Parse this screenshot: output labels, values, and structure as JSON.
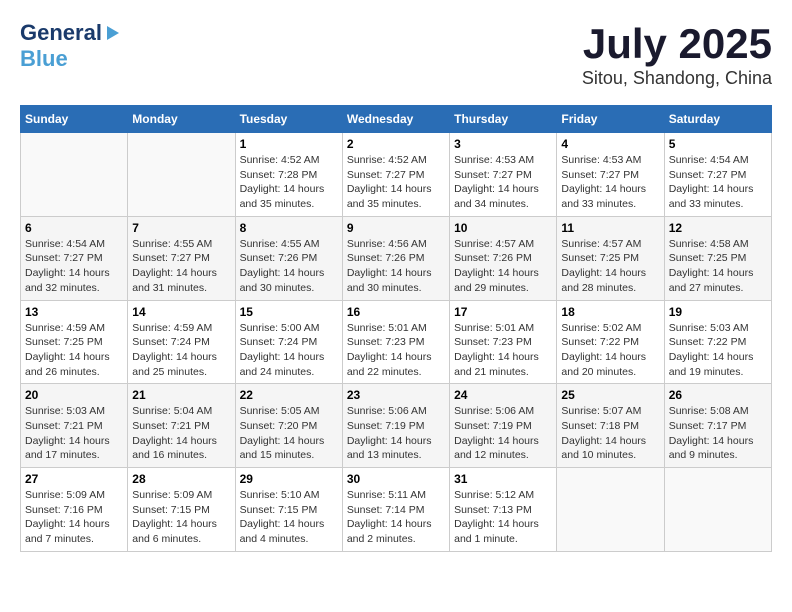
{
  "header": {
    "logo_general": "General",
    "logo_blue": "Blue",
    "month": "July 2025",
    "location": "Sitou, Shandong, China"
  },
  "days_of_week": [
    "Sunday",
    "Monday",
    "Tuesday",
    "Wednesday",
    "Thursday",
    "Friday",
    "Saturday"
  ],
  "weeks": [
    [
      {
        "day": "",
        "sunrise": "",
        "sunset": "",
        "daylight": ""
      },
      {
        "day": "",
        "sunrise": "",
        "sunset": "",
        "daylight": ""
      },
      {
        "day": "1",
        "sunrise": "Sunrise: 4:52 AM",
        "sunset": "Sunset: 7:28 PM",
        "daylight": "Daylight: 14 hours and 35 minutes."
      },
      {
        "day": "2",
        "sunrise": "Sunrise: 4:52 AM",
        "sunset": "Sunset: 7:27 PM",
        "daylight": "Daylight: 14 hours and 35 minutes."
      },
      {
        "day": "3",
        "sunrise": "Sunrise: 4:53 AM",
        "sunset": "Sunset: 7:27 PM",
        "daylight": "Daylight: 14 hours and 34 minutes."
      },
      {
        "day": "4",
        "sunrise": "Sunrise: 4:53 AM",
        "sunset": "Sunset: 7:27 PM",
        "daylight": "Daylight: 14 hours and 33 minutes."
      },
      {
        "day": "5",
        "sunrise": "Sunrise: 4:54 AM",
        "sunset": "Sunset: 7:27 PM",
        "daylight": "Daylight: 14 hours and 33 minutes."
      }
    ],
    [
      {
        "day": "6",
        "sunrise": "Sunrise: 4:54 AM",
        "sunset": "Sunset: 7:27 PM",
        "daylight": "Daylight: 14 hours and 32 minutes."
      },
      {
        "day": "7",
        "sunrise": "Sunrise: 4:55 AM",
        "sunset": "Sunset: 7:27 PM",
        "daylight": "Daylight: 14 hours and 31 minutes."
      },
      {
        "day": "8",
        "sunrise": "Sunrise: 4:55 AM",
        "sunset": "Sunset: 7:26 PM",
        "daylight": "Daylight: 14 hours and 30 minutes."
      },
      {
        "day": "9",
        "sunrise": "Sunrise: 4:56 AM",
        "sunset": "Sunset: 7:26 PM",
        "daylight": "Daylight: 14 hours and 30 minutes."
      },
      {
        "day": "10",
        "sunrise": "Sunrise: 4:57 AM",
        "sunset": "Sunset: 7:26 PM",
        "daylight": "Daylight: 14 hours and 29 minutes."
      },
      {
        "day": "11",
        "sunrise": "Sunrise: 4:57 AM",
        "sunset": "Sunset: 7:25 PM",
        "daylight": "Daylight: 14 hours and 28 minutes."
      },
      {
        "day": "12",
        "sunrise": "Sunrise: 4:58 AM",
        "sunset": "Sunset: 7:25 PM",
        "daylight": "Daylight: 14 hours and 27 minutes."
      }
    ],
    [
      {
        "day": "13",
        "sunrise": "Sunrise: 4:59 AM",
        "sunset": "Sunset: 7:25 PM",
        "daylight": "Daylight: 14 hours and 26 minutes."
      },
      {
        "day": "14",
        "sunrise": "Sunrise: 4:59 AM",
        "sunset": "Sunset: 7:24 PM",
        "daylight": "Daylight: 14 hours and 25 minutes."
      },
      {
        "day": "15",
        "sunrise": "Sunrise: 5:00 AM",
        "sunset": "Sunset: 7:24 PM",
        "daylight": "Daylight: 14 hours and 24 minutes."
      },
      {
        "day": "16",
        "sunrise": "Sunrise: 5:01 AM",
        "sunset": "Sunset: 7:23 PM",
        "daylight": "Daylight: 14 hours and 22 minutes."
      },
      {
        "day": "17",
        "sunrise": "Sunrise: 5:01 AM",
        "sunset": "Sunset: 7:23 PM",
        "daylight": "Daylight: 14 hours and 21 minutes."
      },
      {
        "day": "18",
        "sunrise": "Sunrise: 5:02 AM",
        "sunset": "Sunset: 7:22 PM",
        "daylight": "Daylight: 14 hours and 20 minutes."
      },
      {
        "day": "19",
        "sunrise": "Sunrise: 5:03 AM",
        "sunset": "Sunset: 7:22 PM",
        "daylight": "Daylight: 14 hours and 19 minutes."
      }
    ],
    [
      {
        "day": "20",
        "sunrise": "Sunrise: 5:03 AM",
        "sunset": "Sunset: 7:21 PM",
        "daylight": "Daylight: 14 hours and 17 minutes."
      },
      {
        "day": "21",
        "sunrise": "Sunrise: 5:04 AM",
        "sunset": "Sunset: 7:21 PM",
        "daylight": "Daylight: 14 hours and 16 minutes."
      },
      {
        "day": "22",
        "sunrise": "Sunrise: 5:05 AM",
        "sunset": "Sunset: 7:20 PM",
        "daylight": "Daylight: 14 hours and 15 minutes."
      },
      {
        "day": "23",
        "sunrise": "Sunrise: 5:06 AM",
        "sunset": "Sunset: 7:19 PM",
        "daylight": "Daylight: 14 hours and 13 minutes."
      },
      {
        "day": "24",
        "sunrise": "Sunrise: 5:06 AM",
        "sunset": "Sunset: 7:19 PM",
        "daylight": "Daylight: 14 hours and 12 minutes."
      },
      {
        "day": "25",
        "sunrise": "Sunrise: 5:07 AM",
        "sunset": "Sunset: 7:18 PM",
        "daylight": "Daylight: 14 hours and 10 minutes."
      },
      {
        "day": "26",
        "sunrise": "Sunrise: 5:08 AM",
        "sunset": "Sunset: 7:17 PM",
        "daylight": "Daylight: 14 hours and 9 minutes."
      }
    ],
    [
      {
        "day": "27",
        "sunrise": "Sunrise: 5:09 AM",
        "sunset": "Sunset: 7:16 PM",
        "daylight": "Daylight: 14 hours and 7 minutes."
      },
      {
        "day": "28",
        "sunrise": "Sunrise: 5:09 AM",
        "sunset": "Sunset: 7:15 PM",
        "daylight": "Daylight: 14 hours and 6 minutes."
      },
      {
        "day": "29",
        "sunrise": "Sunrise: 5:10 AM",
        "sunset": "Sunset: 7:15 PM",
        "daylight": "Daylight: 14 hours and 4 minutes."
      },
      {
        "day": "30",
        "sunrise": "Sunrise: 5:11 AM",
        "sunset": "Sunset: 7:14 PM",
        "daylight": "Daylight: 14 hours and 2 minutes."
      },
      {
        "day": "31",
        "sunrise": "Sunrise: 5:12 AM",
        "sunset": "Sunset: 7:13 PM",
        "daylight": "Daylight: 14 hours and 1 minute."
      },
      {
        "day": "",
        "sunrise": "",
        "sunset": "",
        "daylight": ""
      },
      {
        "day": "",
        "sunrise": "",
        "sunset": "",
        "daylight": ""
      }
    ]
  ]
}
